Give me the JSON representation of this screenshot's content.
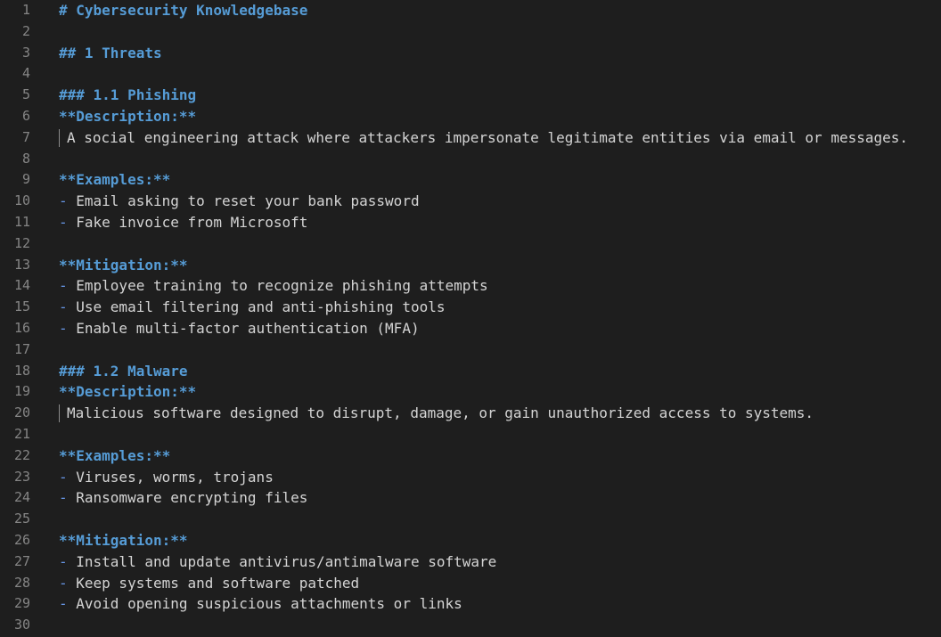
{
  "editor": {
    "lines": [
      {
        "n": "1",
        "type": "heading",
        "text": "# Cybersecurity Knowledgebase"
      },
      {
        "n": "2",
        "type": "blank",
        "text": ""
      },
      {
        "n": "3",
        "type": "heading",
        "text": "## 1 Threats"
      },
      {
        "n": "4",
        "type": "blank",
        "text": ""
      },
      {
        "n": "5",
        "type": "heading",
        "text": "### 1.1 Phishing"
      },
      {
        "n": "6",
        "type": "bold",
        "text": "**Description:**"
      },
      {
        "n": "7",
        "type": "quote",
        "text": "A social engineering attack where attackers impersonate legitimate entities via email or messages."
      },
      {
        "n": "8",
        "type": "blank",
        "text": ""
      },
      {
        "n": "9",
        "type": "bold",
        "text": "**Examples:**"
      },
      {
        "n": "10",
        "type": "list",
        "text": "Email asking to reset your bank password"
      },
      {
        "n": "11",
        "type": "list",
        "text": "Fake invoice from Microsoft"
      },
      {
        "n": "12",
        "type": "blank",
        "text": ""
      },
      {
        "n": "13",
        "type": "bold",
        "text": "**Mitigation:**"
      },
      {
        "n": "14",
        "type": "list",
        "text": "Employee training to recognize phishing attempts"
      },
      {
        "n": "15",
        "type": "list",
        "text": "Use email filtering and anti-phishing tools"
      },
      {
        "n": "16",
        "type": "list",
        "text": "Enable multi-factor authentication (MFA)"
      },
      {
        "n": "17",
        "type": "blank",
        "text": ""
      },
      {
        "n": "18",
        "type": "heading",
        "text": "### 1.2 Malware"
      },
      {
        "n": "19",
        "type": "bold",
        "text": "**Description:**"
      },
      {
        "n": "20",
        "type": "quote",
        "text": "Malicious software designed to disrupt, damage, or gain unauthorized access to systems."
      },
      {
        "n": "21",
        "type": "blank",
        "text": ""
      },
      {
        "n": "22",
        "type": "bold",
        "text": "**Examples:**"
      },
      {
        "n": "23",
        "type": "list",
        "text": "Viruses, worms, trojans"
      },
      {
        "n": "24",
        "type": "list",
        "text": "Ransomware encrypting files"
      },
      {
        "n": "25",
        "type": "blank",
        "text": ""
      },
      {
        "n": "26",
        "type": "bold",
        "text": "**Mitigation:**"
      },
      {
        "n": "27",
        "type": "list",
        "text": "Install and update antivirus/antimalware software"
      },
      {
        "n": "28",
        "type": "list",
        "text": "Keep systems and software patched"
      },
      {
        "n": "29",
        "type": "list",
        "text": "Avoid opening suspicious attachments or links"
      },
      {
        "n": "30",
        "type": "blank",
        "text": ""
      }
    ],
    "list_marker": "- "
  },
  "colors": {
    "background": "#1e1e1e",
    "heading": "#569cd6",
    "text": "#d4d4d4",
    "line_number": "#858585"
  }
}
